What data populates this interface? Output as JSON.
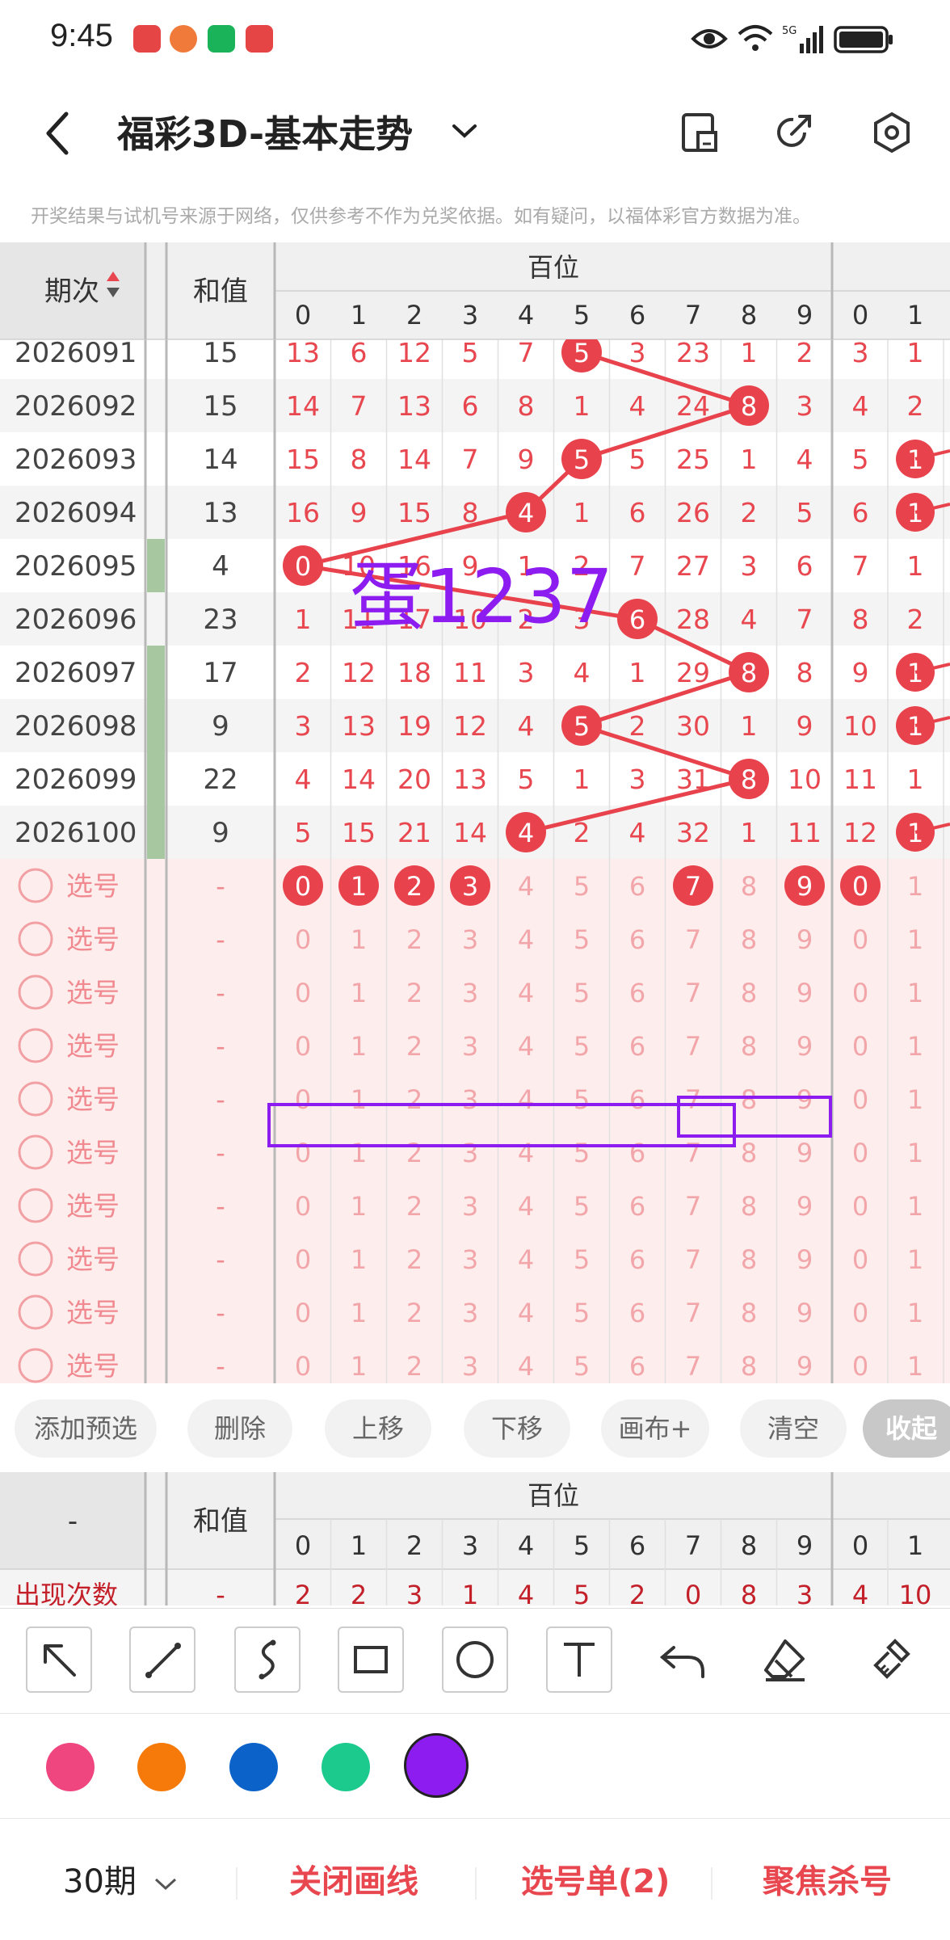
{
  "status": {
    "time": "9:45",
    "app_colors": [
      "#e64545",
      "#e64545",
      "#1ab35a",
      "#e64545"
    ]
  },
  "header": {
    "title": "福彩3D-基本走势"
  },
  "notice": "开奖结果与试机号来源于网络，仅供参考不作为兑奖依据。如有疑问，以福体彩官方数据为准。",
  "table": {
    "col_issue": "期次",
    "col_sum": "和值",
    "group_label": "百位",
    "digits": [
      "0",
      "1",
      "2",
      "3",
      "4",
      "5",
      "6",
      "7",
      "8",
      "9"
    ],
    "rows": [
      {
        "issue": "2026091",
        "sum": "15",
        "miss": [
          "13",
          "6",
          "12",
          "5",
          "7",
          "5",
          "3",
          "23",
          "1",
          "2"
        ],
        "hit": 5,
        "t0": "3",
        "t1": "1",
        "t1hit": false,
        "green": false
      },
      {
        "issue": "2026092",
        "sum": "15",
        "miss": [
          "14",
          "7",
          "13",
          "6",
          "8",
          "1",
          "4",
          "24",
          "8",
          "3"
        ],
        "hit": 8,
        "t0": "4",
        "t1": "2",
        "t1hit": false,
        "green": false
      },
      {
        "issue": "2026093",
        "sum": "14",
        "miss": [
          "15",
          "8",
          "14",
          "7",
          "9",
          "5",
          "5",
          "25",
          "1",
          "4"
        ],
        "hit": 5,
        "t0": "5",
        "t1": "1",
        "t1hit": true,
        "green": false
      },
      {
        "issue": "2026094",
        "sum": "13",
        "miss": [
          "16",
          "9",
          "15",
          "8",
          "4",
          "1",
          "6",
          "26",
          "2",
          "5"
        ],
        "hit": 4,
        "t0": "6",
        "t1": "1",
        "t1hit": true,
        "green": false
      },
      {
        "issue": "2026095",
        "sum": "4",
        "miss": [
          "0",
          "10",
          "16",
          "9",
          "1",
          "2",
          "7",
          "27",
          "3",
          "6"
        ],
        "hit": 0,
        "t0": "7",
        "t1": "1",
        "t1hit": false,
        "green": true
      },
      {
        "issue": "2026096",
        "sum": "23",
        "miss": [
          "1",
          "11",
          "17",
          "10",
          "2",
          "3",
          "6",
          "28",
          "4",
          "7"
        ],
        "hit": 6,
        "t0": "8",
        "t1": "2",
        "t1hit": false,
        "green": false
      },
      {
        "issue": "2026097",
        "sum": "17",
        "miss": [
          "2",
          "12",
          "18",
          "11",
          "3",
          "4",
          "1",
          "29",
          "8",
          "8"
        ],
        "hit": 8,
        "t0": "9",
        "t1": "1",
        "t1hit": true,
        "green": true
      },
      {
        "issue": "2026098",
        "sum": "9",
        "miss": [
          "3",
          "13",
          "19",
          "12",
          "4",
          "5",
          "2",
          "30",
          "1",
          "9"
        ],
        "hit": 5,
        "t0": "10",
        "t1": "1",
        "t1hit": true,
        "green": true
      },
      {
        "issue": "2026099",
        "sum": "22",
        "miss": [
          "4",
          "14",
          "20",
          "13",
          "5",
          "1",
          "3",
          "31",
          "8",
          "10"
        ],
        "hit": 8,
        "t0": "11",
        "t1": "1",
        "t1hit": false,
        "green": true
      },
      {
        "issue": "2026100",
        "sum": "9",
        "miss": [
          "5",
          "15",
          "21",
          "14",
          "4",
          "2",
          "4",
          "32",
          "1",
          "11"
        ],
        "hit": 4,
        "t0": "12",
        "t1": "1",
        "t1hit": true,
        "green": true
      }
    ],
    "select_label": "选号",
    "select_sum": "-",
    "select_count": 10,
    "selected_digits": [
      0,
      1,
      2,
      3,
      7,
      9
    ],
    "selected_t0": true
  },
  "annotation": {
    "text": "蛋1237",
    "color": "#8c1cf0"
  },
  "toolbar": {
    "add": "添加预选",
    "delete": "删除",
    "move_up": "上移",
    "move_down": "下移",
    "canvas": "画布+",
    "clear": "清空",
    "collapse": "收起"
  },
  "stats": {
    "left_header": "-",
    "sum_header": "和值",
    "group_label": "百位",
    "row_label": "出现次数",
    "row_sum": "-",
    "counts": [
      "2",
      "2",
      "3",
      "1",
      "4",
      "5",
      "2",
      "0",
      "8",
      "3"
    ],
    "t0": "4",
    "t1": "10"
  },
  "palette": [
    "#f0467f",
    "#f57a0a",
    "#0b63c9",
    "#1dca8e",
    "#8c1cf0"
  ],
  "bottom_nav": {
    "period": "30期",
    "close_line": "关闭画线",
    "selection": "选号单(2)",
    "focus": "聚焦杀号"
  }
}
